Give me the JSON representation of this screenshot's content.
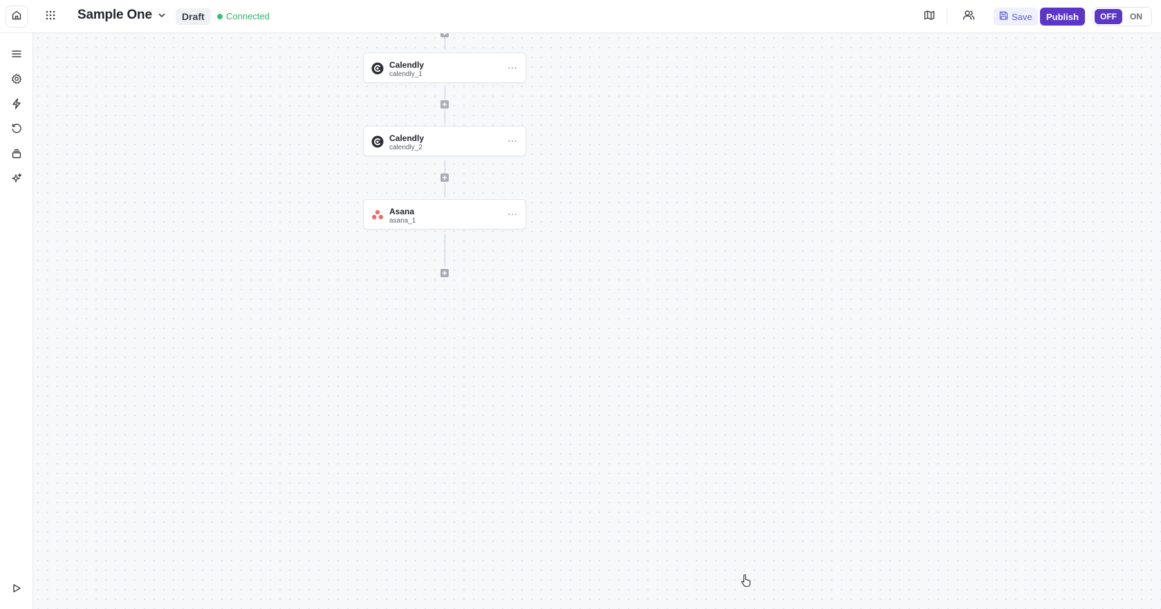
{
  "header": {
    "workflow_title": "Sample One",
    "status_badge": "Draft",
    "connection_status": "Connected",
    "save_label": "Save",
    "publish_label": "Publish",
    "toggle": {
      "off_label": "OFF",
      "on_label": "ON",
      "state": "OFF"
    }
  },
  "sidebar": {
    "items": [
      {
        "icon": "menu-icon"
      },
      {
        "icon": "gear-icon"
      },
      {
        "icon": "lightning-icon"
      },
      {
        "icon": "history-icon"
      },
      {
        "icon": "stack-icon"
      },
      {
        "icon": "sparkle-icon"
      }
    ],
    "bottom": {
      "icon": "play-icon"
    }
  },
  "canvas": {
    "nodes": [
      {
        "title": "Calendly",
        "subtitle": "calendly_1",
        "icon": "calendly-icon"
      },
      {
        "title": "Calendly",
        "subtitle": "calendly_2",
        "icon": "calendly-icon"
      },
      {
        "title": "Asana",
        "subtitle": "asana_1",
        "icon": "asana-icon"
      }
    ],
    "node_menu_glyph": "···"
  },
  "colors": {
    "accent": "#5b36c8",
    "connected": "#37c46f",
    "canvas_bg": "#f6f8fa",
    "asana": "#f06a6a"
  }
}
